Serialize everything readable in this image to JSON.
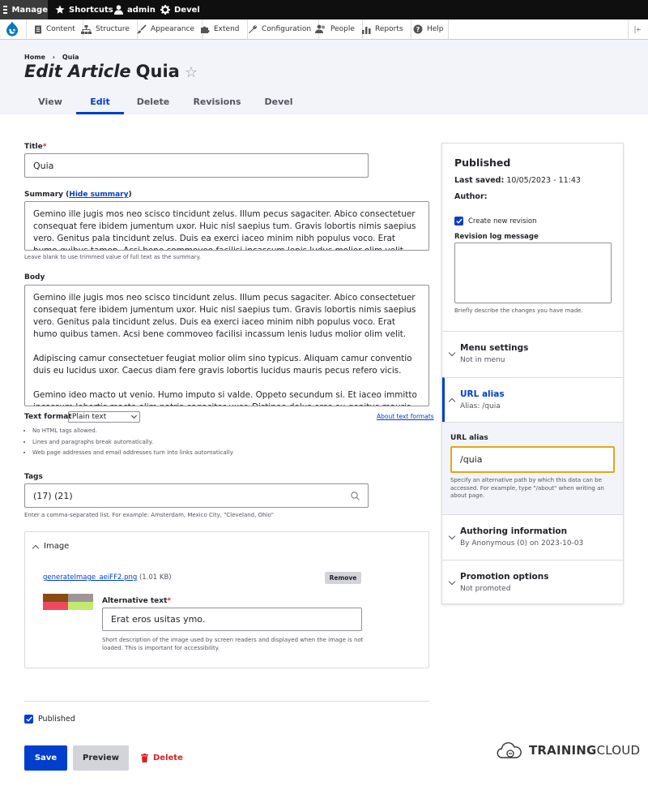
{
  "admin_bar": {
    "manage": "Manage",
    "shortcuts": "Shortcuts",
    "user": "admin",
    "devel": "Devel"
  },
  "toolbar": {
    "items": [
      "Content",
      "Structure",
      "Appearance",
      "Extend",
      "Configuration",
      "People",
      "Reports",
      "Help"
    ]
  },
  "breadcrumb": {
    "home": "Home",
    "separator": "›",
    "current": "Quia"
  },
  "page_title": {
    "prefix": "Edit Article",
    "name": "Quia"
  },
  "tabs": [
    {
      "label": "View",
      "active": false
    },
    {
      "label": "Edit",
      "active": true
    },
    {
      "label": "Delete",
      "active": false
    },
    {
      "label": "Revisions",
      "active": false
    },
    {
      "label": "Devel",
      "active": false
    }
  ],
  "form": {
    "title_label": "Title",
    "title_value": "Quia",
    "summary_label": "Summary",
    "summary_toggle": "Hide summary",
    "summary_text": "Gemino ille jugis mos neo scisco tincidunt zelus. Illum pecus sagaciter. Abico consectetuer consequat fere ibidem jumentum uxor. Huic nisl saepius tum. Gravis lobortis nimis saepius vero. Genitus pala tincidunt zelus. Duis ea exerci iaceo minim nibh populus voco. Erat humo quibus tamen. Acsi bene commoveo facilisi incassum lenis ludus molior olim velit.",
    "summary_help": "Leave blank to use trimmed value of full text as the summary.",
    "body_label": "Body",
    "body_paragraphs": [
      "Gemino ille jugis mos neo scisco tincidunt zelus. Illum pecus sagaciter. Abico consectetuer consequat fere ibidem jumentum uxor. Huic nisl saepius tum. Gravis lobortis nimis saepius vero. Genitus pala tincidunt zelus. Duis ea exerci iaceo minim nibh populus voco. Erat humo quibus tamen. Acsi bene commoveo facilisi incassum lenis ludus molior olim velit.",
      "Adipiscing camur consectetuer feugiat molior olim sino typicus. Aliquam camur conventio duis eu lucidus uxor. Caecus diam fere gravis lobortis lucidus mauris pecus refero vicis.",
      "Gemino ideo macto ut venio. Humo imputo si valde. Oppeto secundum si. Et iaceo immitto incassum lobortis macto olim patria sagaciter uxor. Distineo dolus eros eu genitus mauris nulla sed. Genis enim eu"
    ],
    "text_format_label": "Text format",
    "text_format_value": "Plain text",
    "about_formats": "About text formats",
    "format_tips": [
      "No HTML tags allowed.",
      "Lines and paragraphs break automatically.",
      "Web page addresses and email addresses turn into links automatically."
    ],
    "tags_label": "Tags",
    "tags_value": "(17) (21)",
    "tags_help": "Enter a comma-separated list. For example: Amsterdam, Mexico City, \"Cleveland, Ohio\"",
    "image_label": "Image",
    "image_file": "generateImage_aeiFF2.png",
    "image_size": "(1.01 KB)",
    "remove_button": "Remove",
    "alt_label": "Alternative text",
    "alt_value": "Erat eros usitas ymo.",
    "alt_help": "Short description of the image used by screen readers and displayed when the image is not loaded. This is important for accessibility.",
    "thumb_colors": [
      "#8a4a14",
      "#9e9696",
      "#ee4a5e",
      "#c2ea6e"
    ],
    "published_label": "Published",
    "save": "Save",
    "preview": "Preview",
    "delete": "Delete"
  },
  "sidebar": {
    "status": "Published",
    "last_saved_label": "Last saved:",
    "last_saved_value": "10/05/2023 - 11:43",
    "author_label": "Author:",
    "create_revision": "Create new revision",
    "revision_log_label": "Revision log message",
    "revision_help": "Briefly describe the changes you have made.",
    "menu_title": "Menu settings",
    "menu_summary": "Not in menu",
    "url_title": "URL alias",
    "url_summary": "Alias: /quia",
    "url_field_label": "URL alias",
    "url_field_value": "/quia",
    "url_help": "Specify an alternative path by which this data can be accessed. For example, type \"/about\" when writing an about page.",
    "authoring_title": "Authoring information",
    "authoring_summary": "By Anonymous (0) on 2023-10-03",
    "promotion_title": "Promotion options",
    "promotion_summary": "Not promoted"
  },
  "logo": {
    "text_bold": "TRAINING",
    "text_light": "CLOUD"
  },
  "colors": {
    "accent": "#003ecc",
    "danger": "#d72222",
    "focus": "#e3a51b"
  }
}
